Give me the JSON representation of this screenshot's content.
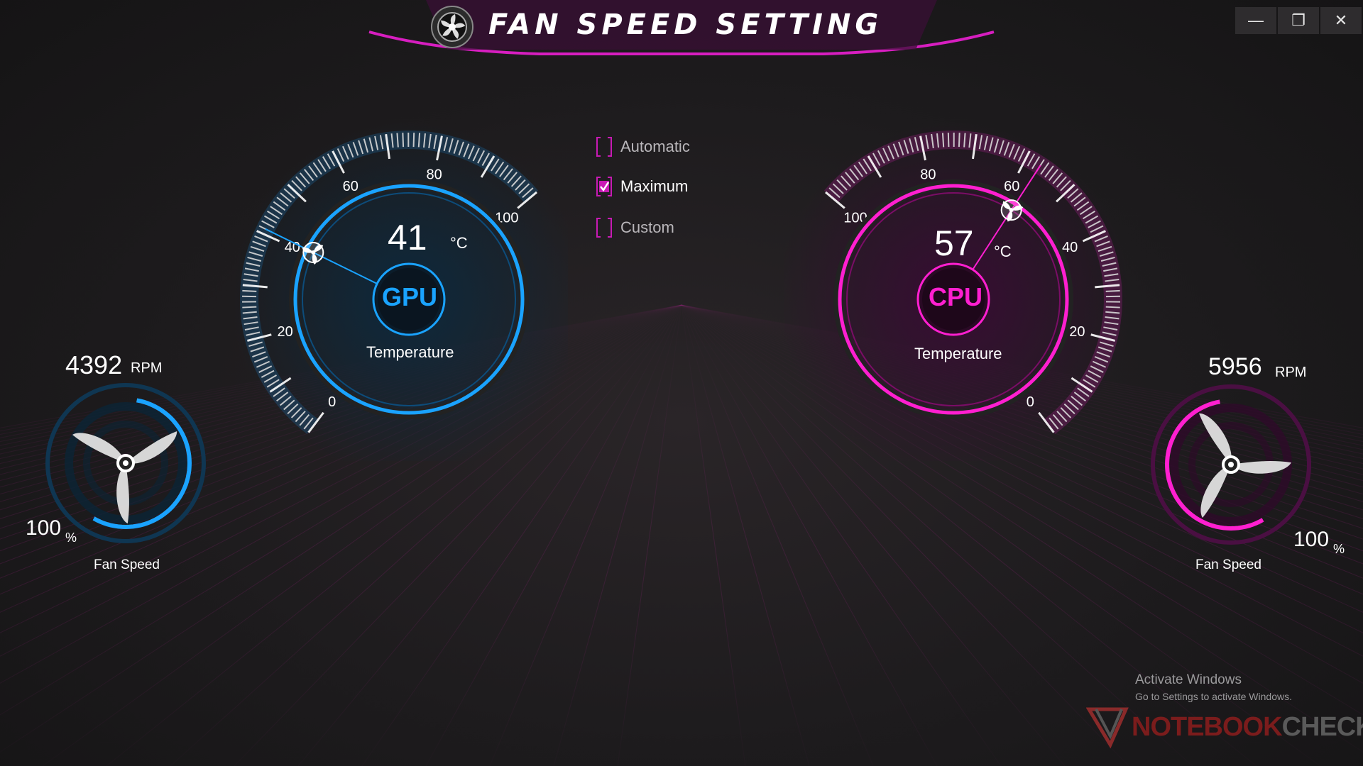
{
  "window": {
    "title": "FAN SPEED SETTING",
    "controls": {
      "minimize": "—",
      "restore": "❐",
      "close": "✕"
    }
  },
  "modes": [
    {
      "label": "Automatic",
      "checked": false
    },
    {
      "label": "Maximum",
      "checked": true
    },
    {
      "label": "Custom",
      "checked": false
    }
  ],
  "gpu": {
    "chip_label": "GPU",
    "temperature_value": "41",
    "temperature_unit": "°C",
    "temperature_caption": "Temperature",
    "gauge_ticks": [
      "0",
      "20",
      "40",
      "60",
      "80",
      "100"
    ],
    "needle_value": 41,
    "accent": "#1aa3ff"
  },
  "cpu": {
    "chip_label": "CPU",
    "temperature_value": "57",
    "temperature_unit": "°C",
    "temperature_caption": "Temperature",
    "gauge_ticks": [
      "0",
      "20",
      "40",
      "60",
      "80",
      "100"
    ],
    "needle_value": 57,
    "accent": "#ff1fd0"
  },
  "gpu_fan": {
    "rpm_value": "4392",
    "rpm_unit": "RPM",
    "percent_value": "100",
    "percent_unit": "%",
    "caption": "Fan Speed",
    "level": 1.0
  },
  "cpu_fan": {
    "rpm_value": "5956",
    "rpm_unit": "RPM",
    "percent_value": "100",
    "percent_unit": "%",
    "caption": "Fan Speed",
    "level": 1.0
  },
  "activation": {
    "line1": "Activate Windows",
    "line2": "Go to Settings to activate Windows."
  },
  "watermark": {
    "brand_a": "NOTEBOOK",
    "brand_b": "CHECK"
  },
  "colors": {
    "magenta": "#d71ec0",
    "blue": "#1aa3ff",
    "pink_title": "#c81ab4"
  }
}
